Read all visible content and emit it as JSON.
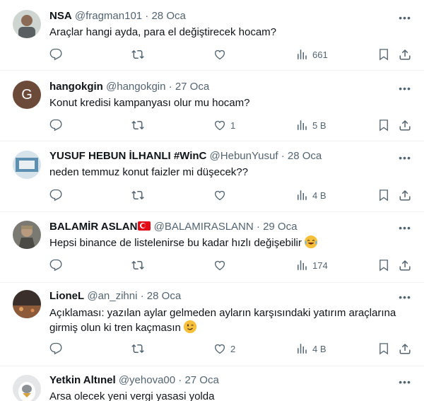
{
  "tweets": [
    {
      "name": "NSA",
      "handle": "@fragman101",
      "dot": "·",
      "date": "28 Oca",
      "text": "Araçlar hangi ayda, para el değiştirecek hocam?",
      "likes": "",
      "views": "661",
      "emoji": false
    },
    {
      "name": "hangokgin",
      "handle": "@hangokgin",
      "dot": "·",
      "date": "27 Oca",
      "avatar_letter": "G",
      "text": "Konut kredisi kampanyası olur mu hocam?",
      "likes": "1",
      "views": "5 B",
      "emoji": false
    },
    {
      "name": "YUSUF HEBUN İLHANLI #WinC",
      "handle": "@HebunYusuf",
      "dot": "·",
      "date": "28 Oca",
      "text": "neden temmuz konut faizler mi düşecek??",
      "likes": "",
      "views": "4 B",
      "emoji": false
    },
    {
      "name": "BALAMİR ASLAN",
      "handle": "@BALAMIRASLANN",
      "dot": "·",
      "date": "29 Oca",
      "text": "Hepsi binance de listelenirse bu kadar hızlı değişebilir",
      "likes": "",
      "views": "174",
      "emoji": true,
      "emoji_name": "tears-of-joy-emoji"
    },
    {
      "name": "LioneL",
      "handle": "@an_zihni",
      "dot": "·",
      "date": "28 Oca",
      "text": "Açıklaması: yazılan aylar gelmeden ayların karşısındaki yatırım araçlarına girmiş olun ki tren kaçmasın",
      "likes": "2",
      "views": "4 B",
      "emoji": true,
      "emoji_name": "winking-face-emoji"
    },
    {
      "name": "Yetkin Altınel",
      "handle": "@yehova00",
      "dot": "·",
      "date": "27 Oca",
      "text": "Arsa olecek yeni vergi yasasi yolda",
      "likes": "",
      "views": "",
      "emoji": false
    }
  ],
  "icons": [
    "reply-icon",
    "retweet-icon",
    "like-icon",
    "views-icon",
    "bookmark-icon",
    "share-icon",
    "more-icon"
  ],
  "colors": {
    "muted": "#536471",
    "text": "#0f1419",
    "divider": "#eff3f4",
    "flag_red": "#e30a17"
  }
}
